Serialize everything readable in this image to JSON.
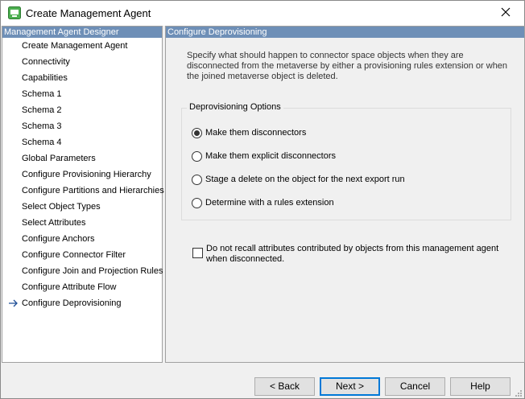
{
  "window": {
    "title": "Create Management Agent",
    "app_icon": "management-agent-icon",
    "close_icon": "close-icon"
  },
  "left_panel": {
    "header": "Management Agent Designer",
    "items": [
      {
        "label": "Create Management Agent",
        "current": false
      },
      {
        "label": "Connectivity",
        "current": false
      },
      {
        "label": "Capabilities",
        "current": false
      },
      {
        "label": "Schema 1",
        "current": false
      },
      {
        "label": "Schema 2",
        "current": false
      },
      {
        "label": "Schema 3",
        "current": false
      },
      {
        "label": "Schema 4",
        "current": false
      },
      {
        "label": "Global Parameters",
        "current": false
      },
      {
        "label": "Configure Provisioning Hierarchy",
        "current": false
      },
      {
        "label": "Configure Partitions and Hierarchies",
        "current": false
      },
      {
        "label": "Select Object Types",
        "current": false
      },
      {
        "label": "Select Attributes",
        "current": false
      },
      {
        "label": "Configure Anchors",
        "current": false
      },
      {
        "label": "Configure Connector Filter",
        "current": false
      },
      {
        "label": "Configure Join and Projection Rules",
        "current": false
      },
      {
        "label": "Configure Attribute Flow",
        "current": false
      },
      {
        "label": "Configure Deprovisioning",
        "current": true
      }
    ],
    "current_indicator_icon": "arrow-right-icon"
  },
  "right_panel": {
    "header": "Configure Deprovisioning",
    "description": "Specify what should happen to connector space objects when they are disconnected from the metaverse by either a provisioning rules extension or when the joined metaverse object is deleted.",
    "options_group": {
      "legend": "Deprovisioning Options",
      "options": [
        {
          "label": "Make them disconnectors",
          "checked": true
        },
        {
          "label": "Make them explicit disconnectors",
          "checked": false
        },
        {
          "label": "Stage a delete on the object for the next export run",
          "checked": false
        },
        {
          "label": "Determine with a rules extension",
          "checked": false
        }
      ]
    },
    "recall_checkbox": {
      "label": "Do not recall attributes contributed by objects from this management agent when disconnected.",
      "checked": false
    }
  },
  "buttons": {
    "back": "< Back",
    "next": "Next >",
    "cancel": "Cancel",
    "help": "Help"
  },
  "colors": {
    "panel_header_bg": "#6e8fb7",
    "accent": "#0078d7"
  }
}
